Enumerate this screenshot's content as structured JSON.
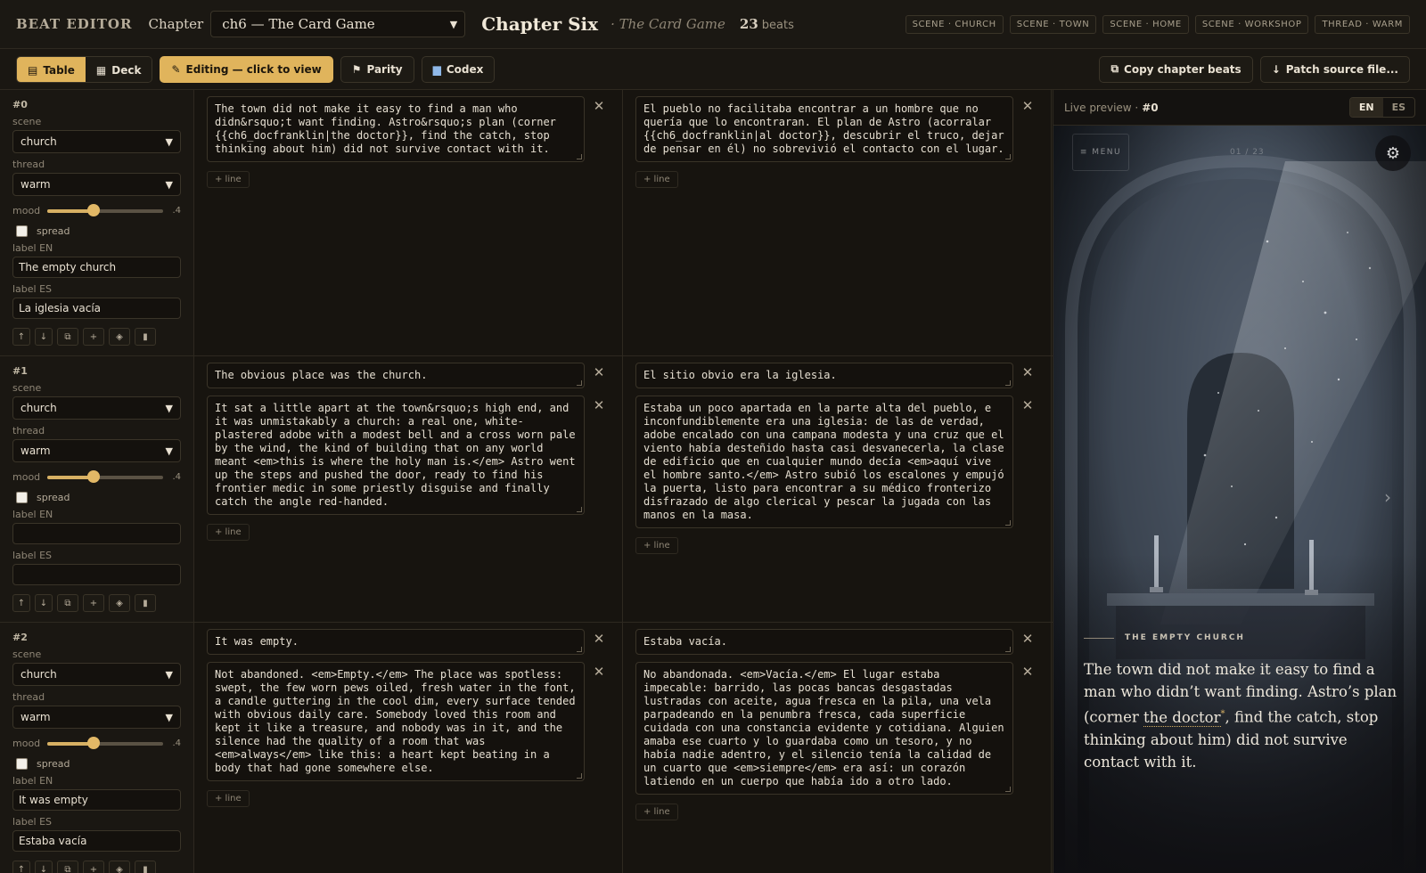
{
  "header": {
    "brand": "BEAT EDITOR",
    "chapter_label": "Chapter",
    "chapter_value": "ch6 — The Card Game",
    "title": "Chapter Six",
    "subtitle": "· The Card Game",
    "beat_count": "23",
    "beat_unit": "beats",
    "tags": [
      "SCENE · CHURCH",
      "SCENE · TOWN",
      "SCENE · HOME",
      "SCENE · WORKSHOP",
      "THREAD · WARM"
    ]
  },
  "toolbar": {
    "table": "Table",
    "deck": "Deck",
    "editing": "Editing — click to view",
    "parity": "Parity",
    "codex": "Codex",
    "copy": "Copy chapter beats",
    "patch": "Patch source file..."
  },
  "labels": {
    "scene": "scene",
    "thread": "thread",
    "mood": "mood",
    "spread": "spread",
    "label_en": "label EN",
    "label_es": "label ES",
    "add_line": "+ line"
  },
  "beats": [
    {
      "id": "#0",
      "scene": "church",
      "thread": "warm",
      "mood": 0.4,
      "mood_text": ".4",
      "label_en": "The empty church",
      "label_es": "La iglesia vacía",
      "en": [
        "The town did not make it easy to find a man who didn&rsquo;t want finding. Astro&rsquo;s plan (corner {{ch6_docfranklin|the doctor}}, find the catch, stop thinking about him) did not survive contact with it."
      ],
      "es": [
        "El pueblo no facilitaba encontrar a un hombre que no quería que lo encontraran. El plan de Astro (acorralar {{ch6_docfranklin|al doctor}}, descubrir el truco, dejar de pensar en él) no sobrevivió el contacto con el lugar."
      ]
    },
    {
      "id": "#1",
      "scene": "church",
      "thread": "warm",
      "mood": 0.4,
      "mood_text": ".4",
      "label_en": "",
      "label_es": "",
      "en": [
        "The obvious place was the church.",
        "It sat a little apart at the town&rsquo;s high end, and it was unmistakably a church: a real one, white-plastered adobe with a modest bell and a cross worn pale by the wind, the kind of building that on any world meant <em>this is where the holy man is.</em> Astro went up the steps and pushed the door, ready to find his frontier medic in some priestly disguise and finally catch the angle red-handed."
      ],
      "es": [
        "El sitio obvio era la iglesia.",
        "Estaba un poco apartada en la parte alta del pueblo, e inconfundiblemente era una iglesia: de las de verdad, adobe encalado con una campana modesta y una cruz que el viento había desteñido hasta casi desvanecerla, la clase de edificio que en cualquier mundo decía <em>aquí vive el hombre santo.</em> Astro subió los escalones y empujó la puerta, listo para encontrar a su médico fronterizo disfrazado de algo clerical y pescar la jugada con las manos en la masa."
      ]
    },
    {
      "id": "#2",
      "scene": "church",
      "thread": "warm",
      "mood": 0.4,
      "mood_text": ".4",
      "label_en": "It was empty",
      "label_es": "Estaba vacía",
      "en": [
        "It was empty.",
        "Not abandoned. <em>Empty.</em> The place was spotless: swept, the few worn pews oiled, fresh water in the font, a candle guttering in the cool dim, every surface tended with obvious daily care. Somebody loved this room and kept it like a treasure, and nobody was in it, and the silence had the quality of a room that was <em>always</em> like this: a heart kept beating in a body that had gone somewhere else."
      ],
      "es": [
        "Estaba vacía.",
        "No abandonada. <em>Vacía.</em> El lugar estaba impecable: barrido, las pocas bancas desgastadas lustradas con aceite, agua fresca en la pila, una vela parpadeando en la penumbra fresca, cada superficie cuidada con una constancia evidente y cotidiana. Alguien amaba ese cuarto y lo guardaba como un tesoro, y no había nadie adentro, y el silencio tenía la calidad de un cuarto que <em>siempre</em> era así: un corazón latiendo en un cuerpo que había ido a otro lado."
      ]
    }
  ],
  "preview": {
    "label": "Live preview ·",
    "beat": "#0",
    "lang_en": "EN",
    "lang_es": "ES",
    "menu": "≡ MENU",
    "counter": "01 / 23",
    "scene_label": "THE EMPTY CHURCH",
    "prose_a": "The town did not make it easy to find a man who didn’t want finding. Astro’s plan (corner ",
    "prose_link": "the doctor",
    "prose_mark": "*",
    "prose_b": ", find the catch, stop thinking about him) did not survive contact with it."
  },
  "colors": {
    "accent": "#e0b45c",
    "background": "#17140f",
    "border": "#2e2920"
  },
  "icons": {
    "table": "table-icon",
    "deck": "deck-icon",
    "edit": "pencil-icon",
    "parity": "flag-icon",
    "codex": "book-icon",
    "copy": "copy-icon",
    "patch": "download-icon",
    "gear": "gear-icon"
  }
}
